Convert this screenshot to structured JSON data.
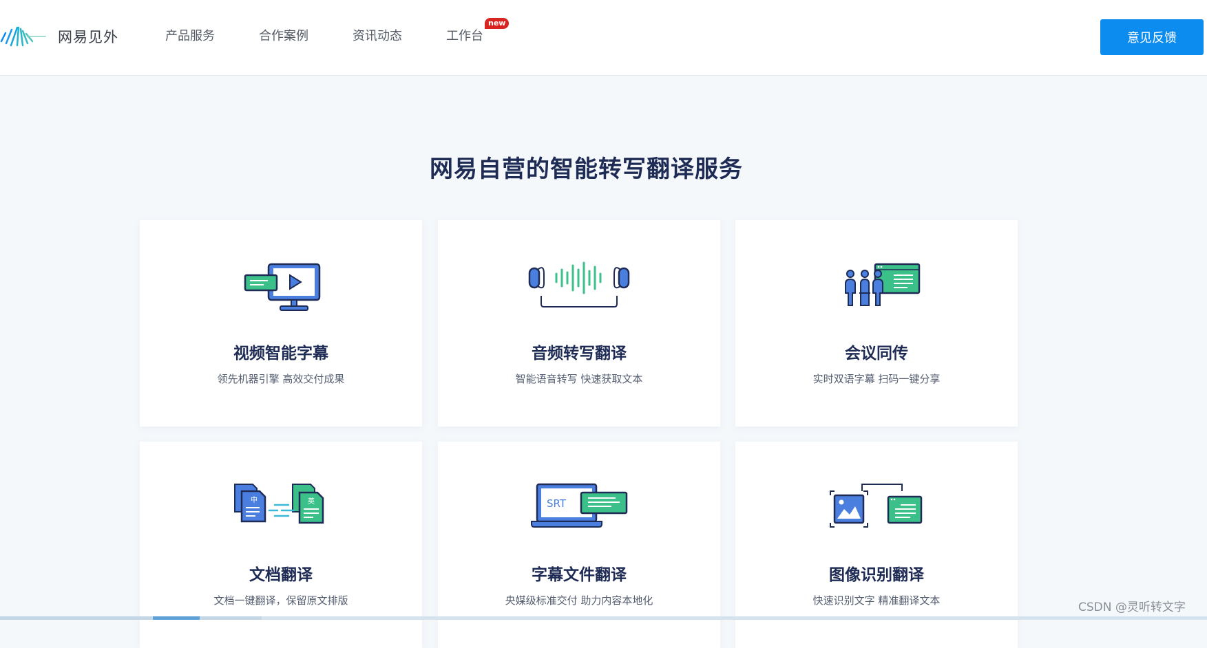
{
  "brand": {
    "name": "网易见外",
    "logo_icon": "netease-jianwai-logo"
  },
  "nav": {
    "items": [
      {
        "label": "产品服务"
      },
      {
        "label": "合作案例"
      },
      {
        "label": "资讯动态"
      },
      {
        "label": "工作台",
        "badge": "new"
      }
    ]
  },
  "feedback_button": {
    "label": "意见反馈"
  },
  "section": {
    "title": "网易自营的智能转写翻译服务"
  },
  "cards": [
    {
      "title": "视频智能字幕",
      "desc": "领先机器引擎 高效交付成果",
      "icon": "video-subtitle-icon"
    },
    {
      "title": "音频转写翻译",
      "desc": "智能语音转写 快速获取文本",
      "icon": "audio-transcription-icon"
    },
    {
      "title": "会议同传",
      "desc": "实时双语字幕 扫码一键分享",
      "icon": "meeting-interpretation-icon"
    },
    {
      "title": "文档翻译",
      "desc": "文档一键翻译，保留原文排版",
      "icon": "document-translation-icon",
      "glyphs": {
        "source": "中",
        "target": "英"
      }
    },
    {
      "title": "字幕文件翻译",
      "desc": "央媒级标准交付 助力内容本地化",
      "icon": "subtitle-file-icon",
      "glyphs": {
        "format": "SRT"
      }
    },
    {
      "title": "图像识别翻译",
      "desc": "快速识别文字 精准翻译文本",
      "icon": "image-ocr-icon"
    }
  ],
  "watermark": "CSDN @灵听转文字",
  "colors": {
    "primary": "#0d8cf0",
    "title": "#1e2b55",
    "icon_blue": "#4a7fe0",
    "icon_green": "#3cc08a",
    "badge": "#d9251f"
  }
}
